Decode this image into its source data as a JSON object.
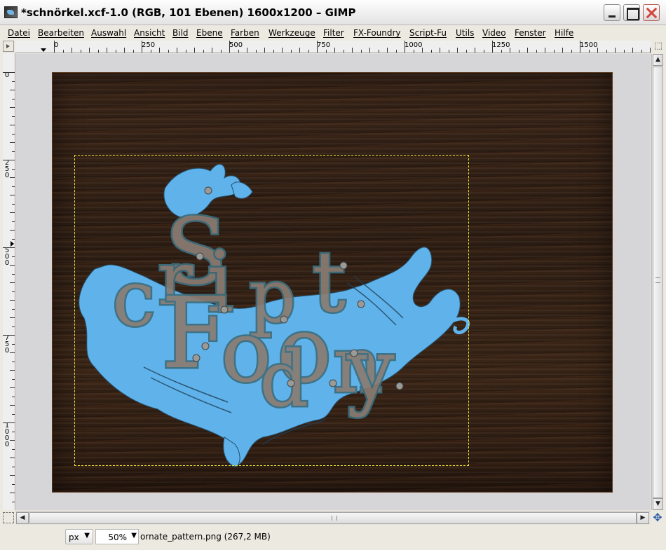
{
  "window": {
    "title": "*schnörkel.xcf-1.0 (RGB, 101 Ebenen) 1600x1200 – GIMP",
    "icons": {
      "app": "gimp-app-icon",
      "minimize": "minimize-icon",
      "maximize": "maximize-icon",
      "close": "close-icon"
    }
  },
  "menu": [
    "Datei",
    "Bearbeiten",
    "Auswahl",
    "Ansicht",
    "Bild",
    "Ebene",
    "Farben",
    "Werkzeuge",
    "Filter",
    "FX-Foundry",
    "Script-Fu",
    "Utils",
    "Video",
    "Fenster",
    "Hilfe"
  ],
  "rulers": {
    "horizontal_labels": [
      "0",
      "250",
      "500",
      "750",
      "1000",
      "1250",
      "1500"
    ],
    "vertical_labels": [
      "0",
      "250",
      "500",
      "750",
      "1000"
    ]
  },
  "status": {
    "unit": "px",
    "zoom": "50%",
    "message": "ornate_pattern.png (267,2 MB)"
  },
  "colors": {
    "wood_dark": "#2f1f14",
    "ornament_blue": "#5fb2ea",
    "letter_fill": "#8a7c72",
    "letter_outline": "#3d6e7e",
    "selection": "#e8e231"
  },
  "artwork": {
    "letters": [
      "S",
      "c",
      "r",
      "i",
      "p",
      "t",
      "F",
      "o",
      "o",
      "n",
      "d",
      "y"
    ]
  }
}
